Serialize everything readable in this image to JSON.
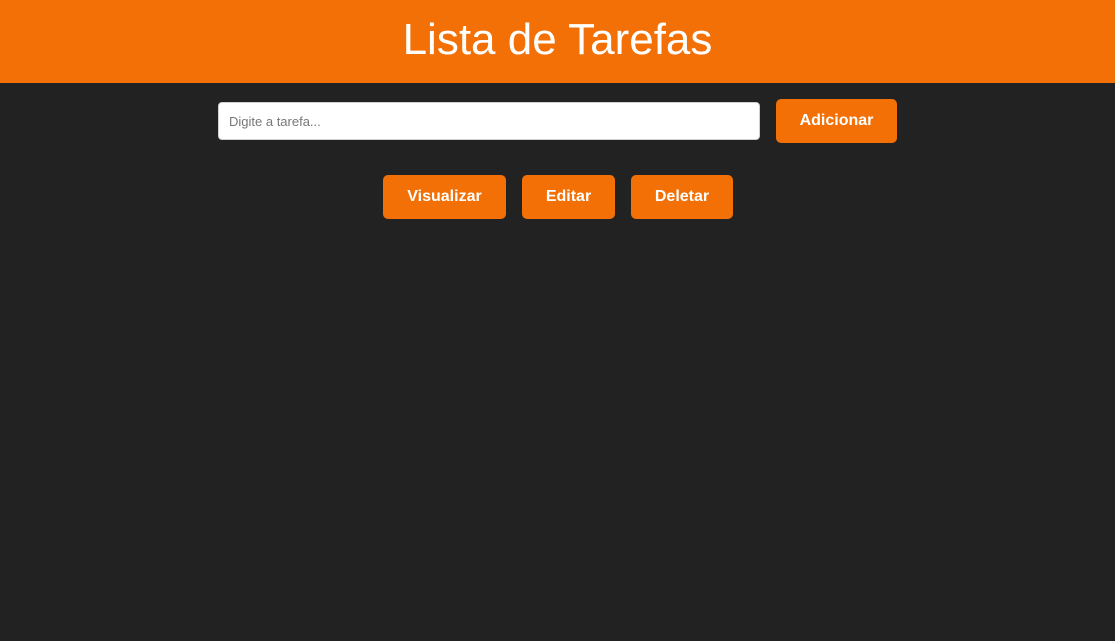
{
  "header": {
    "title": "Lista de Tarefas"
  },
  "task_form": {
    "input_value": "",
    "input_placeholder": "Digite a tarefa...",
    "add_label": "Adicionar"
  },
  "actions": {
    "view_label": "Visualizar",
    "edit_label": "Editar",
    "delete_label": "Deletar"
  },
  "colors": {
    "accent": "#f27005",
    "background": "#222222",
    "button_text": "#ffffff"
  }
}
